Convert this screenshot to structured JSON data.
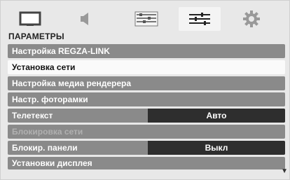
{
  "header": {
    "title": "ПАРАМЕТРЫ",
    "tabs": [
      {
        "icon": "picture-icon",
        "active": false
      },
      {
        "icon": "sound-icon",
        "active": false
      },
      {
        "icon": "preferences-icon",
        "active": false
      },
      {
        "icon": "setup-sliders-icon",
        "active": true
      },
      {
        "icon": "gear-icon",
        "active": false
      }
    ]
  },
  "menu": {
    "items": [
      {
        "label": "Настройка REGZA-LINK"
      },
      {
        "label": "Установка сети"
      },
      {
        "label": "Настройка медиа рендерера"
      },
      {
        "label": "Настр. фоторамки"
      },
      {
        "label": "Телетекст",
        "value": "Авто"
      },
      {
        "label": "Блокировка сети"
      },
      {
        "label": "Блокир. панели",
        "value": "Выкл"
      },
      {
        "label": "Установки дисплея"
      }
    ]
  },
  "colors": {
    "row": "#8a8a8a",
    "selected_row": "#fafafa",
    "value_box": "#2e2e2e",
    "disabled_text": "#b0b0b0"
  },
  "scroll": {
    "icon": "scroll-down-arrow-icon"
  }
}
